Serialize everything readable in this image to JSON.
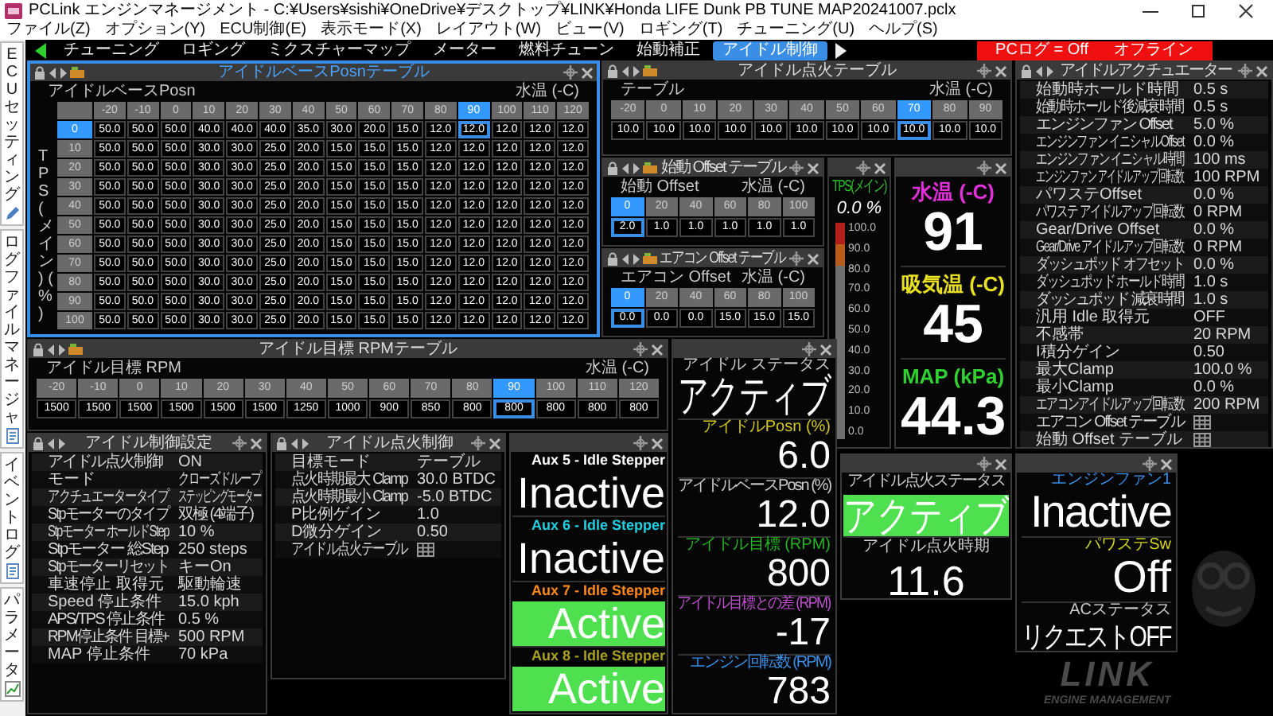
{
  "window": {
    "title": "PCLink エンジンマネージメント - C:¥Users¥sishi¥OneDrive¥デスクトップ¥LINK¥Honda LIFE Dunk PB TUNE MAP20241007.pclx"
  },
  "menu": [
    "ファイル(Z)",
    "オプション(Y)",
    "ECU制御(E)",
    "表示モード(X)",
    "レイアウト(W)",
    "ビュー(V)",
    "ロギング(T)",
    "チューニング(U)",
    "ヘルプ(S)"
  ],
  "side_tabs": [
    {
      "label": "ECUセッティング",
      "kind": "pencil"
    },
    {
      "label": "ログファイルマネージャ",
      "kind": "document"
    },
    {
      "label": "イベントログ",
      "kind": "document"
    },
    {
      "label": "パラメータ",
      "kind": "chart"
    }
  ],
  "tabs": [
    {
      "label": "チューニング",
      "selected": false
    },
    {
      "label": "ロギング",
      "selected": false
    },
    {
      "label": "ミクスチャーマップ",
      "selected": false
    },
    {
      "label": "メーター",
      "selected": false
    },
    {
      "label": "燃料チューン",
      "selected": false
    },
    {
      "label": "始動補正",
      "selected": false
    },
    {
      "label": "アイドル制御",
      "selected": true
    }
  ],
  "status": {
    "pc_log": "PCログ = Off",
    "connection": "オフライン"
  },
  "panels": [
    {
      "kind": "table",
      "title": "アイドルベースPosnテーブル",
      "focused": true,
      "label": "アイドルベースPosn",
      "axis_label": "水温 (-C)",
      "row_axis_label": "TPS (メイン) (%)",
      "columns": [
        {
          "label": "-20",
          "selected": false
        },
        {
          "label": "-10",
          "selected": false
        },
        {
          "label": "0",
          "selected": false
        },
        {
          "label": "10",
          "selected": false
        },
        {
          "label": "20",
          "selected": false
        },
        {
          "label": "30",
          "selected": false
        },
        {
          "label": "40",
          "selected": false
        },
        {
          "label": "50",
          "selected": false
        },
        {
          "label": "60",
          "selected": false
        },
        {
          "label": "70",
          "selected": false
        },
        {
          "label": "80",
          "selected": false
        },
        {
          "label": "90",
          "selected": true
        },
        {
          "label": "100",
          "selected": false
        },
        {
          "label": "110",
          "selected": false
        },
        {
          "label": "120",
          "selected": false
        }
      ],
      "rows": [
        {
          "label": "0",
          "selected": true,
          "cells": [
            "50.0",
            "50.0",
            "50.0",
            "40.0",
            "40.0",
            "40.0",
            "35.0",
            "30.0",
            "20.0",
            "15.0",
            "12.0",
            "12.0",
            "12.0",
            "12.0",
            "12.0"
          ]
        },
        {
          "label": "10",
          "selected": false,
          "cells": [
            "50.0",
            "50.0",
            "50.0",
            "30.0",
            "30.0",
            "25.0",
            "20.0",
            "15.0",
            "15.0",
            "15.0",
            "12.0",
            "12.0",
            "12.0",
            "12.0",
            "12.0"
          ]
        },
        {
          "label": "20",
          "selected": false,
          "cells": [
            "50.0",
            "50.0",
            "50.0",
            "30.0",
            "30.0",
            "25.0",
            "20.0",
            "15.0",
            "15.0",
            "15.0",
            "12.0",
            "12.0",
            "12.0",
            "12.0",
            "12.0"
          ]
        },
        {
          "label": "30",
          "selected": false,
          "cells": [
            "50.0",
            "50.0",
            "50.0",
            "30.0",
            "30.0",
            "25.0",
            "20.0",
            "15.0",
            "15.0",
            "15.0",
            "12.0",
            "12.0",
            "12.0",
            "12.0",
            "12.0"
          ]
        },
        {
          "label": "40",
          "selected": false,
          "cells": [
            "50.0",
            "50.0",
            "50.0",
            "30.0",
            "30.0",
            "25.0",
            "20.0",
            "15.0",
            "15.0",
            "15.0",
            "12.0",
            "12.0",
            "12.0",
            "12.0",
            "12.0"
          ]
        },
        {
          "label": "50",
          "selected": false,
          "cells": [
            "50.0",
            "50.0",
            "50.0",
            "30.0",
            "30.0",
            "25.0",
            "20.0",
            "15.0",
            "15.0",
            "15.0",
            "12.0",
            "12.0",
            "12.0",
            "12.0",
            "12.0"
          ]
        },
        {
          "label": "60",
          "selected": false,
          "cells": [
            "50.0",
            "50.0",
            "50.0",
            "30.0",
            "30.0",
            "25.0",
            "20.0",
            "15.0",
            "15.0",
            "15.0",
            "12.0",
            "12.0",
            "12.0",
            "12.0",
            "12.0"
          ]
        },
        {
          "label": "70",
          "selected": false,
          "cells": [
            "50.0",
            "50.0",
            "50.0",
            "30.0",
            "30.0",
            "25.0",
            "20.0",
            "15.0",
            "15.0",
            "15.0",
            "12.0",
            "12.0",
            "12.0",
            "12.0",
            "12.0"
          ]
        },
        {
          "label": "80",
          "selected": false,
          "cells": [
            "50.0",
            "50.0",
            "50.0",
            "30.0",
            "30.0",
            "25.0",
            "20.0",
            "15.0",
            "15.0",
            "15.0",
            "12.0",
            "12.0",
            "12.0",
            "12.0",
            "12.0"
          ]
        },
        {
          "label": "90",
          "selected": false,
          "cells": [
            "50.0",
            "50.0",
            "50.0",
            "30.0",
            "30.0",
            "25.0",
            "20.0",
            "15.0",
            "15.0",
            "15.0",
            "12.0",
            "12.0",
            "12.0",
            "12.0",
            "12.0"
          ]
        },
        {
          "label": "100",
          "selected": false,
          "cells": [
            "50.0",
            "50.0",
            "50.0",
            "30.0",
            "30.0",
            "25.0",
            "20.0",
            "15.0",
            "15.0",
            "15.0",
            "12.0",
            "12.0",
            "12.0",
            "12.0",
            "12.0"
          ]
        }
      ]
    },
    {
      "kind": "table",
      "title": "アイドル点火テーブル",
      "focused": false,
      "label": "テーブル",
      "axis_label": "水温 (-C)",
      "columns": [
        {
          "label": "-20",
          "selected": false
        },
        {
          "label": "0",
          "selected": false
        },
        {
          "label": "10",
          "selected": false
        },
        {
          "label": "20",
          "selected": false
        },
        {
          "label": "30",
          "selected": false
        },
        {
          "label": "40",
          "selected": false
        },
        {
          "label": "50",
          "selected": false
        },
        {
          "label": "60",
          "selected": false
        },
        {
          "label": "70",
          "selected": true
        },
        {
          "label": "80",
          "selected": false
        },
        {
          "label": "90",
          "selected": false
        }
      ],
      "rows": [
        {
          "cells": [
            "10.0",
            "10.0",
            "10.0",
            "10.0",
            "10.0",
            "10.0",
            "10.0",
            "10.0",
            "10.0",
            "10.0",
            "10.0"
          ]
        }
      ]
    },
    {
      "kind": "settings",
      "title": "アイドルアクチュエーター",
      "focused": false,
      "rows": [
        {
          "kind": "value",
          "label": "始動時ホールド時間",
          "value": "0.5 s"
        },
        {
          "kind": "value",
          "label": "始動時ホールド後減衰時間",
          "value": "0.5 s"
        },
        {
          "kind": "value",
          "label": "エンジンファン Offset",
          "value": "5.0 %"
        },
        {
          "kind": "value",
          "label": "エンジンファン イニシャルOffset",
          "value": "0.0 %"
        },
        {
          "kind": "value",
          "label": "エンジンファン イニシャル時間",
          "value": "100 ms"
        },
        {
          "kind": "value",
          "label": "エンジンファン アイドルアップ回転数",
          "value": "100 RPM"
        },
        {
          "kind": "value",
          "label": "パワステOffset",
          "value": "0.0 %"
        },
        {
          "kind": "value",
          "label": "パワステ アイドルアップ回転数",
          "value": "0 RPM"
        },
        {
          "kind": "value",
          "label": "Gear/Drive Offset",
          "value": "0.0 %"
        },
        {
          "kind": "value",
          "label": "Gear/Drive アイドルアップ回転数",
          "value": "0 RPM"
        },
        {
          "kind": "value",
          "label": "ダッシュポッド オフセット",
          "value": "0.0 %"
        },
        {
          "kind": "value",
          "label": "ダッシュポッド ホールド時間",
          "value": "1.0 s"
        },
        {
          "kind": "value",
          "label": "ダッシュポッド 減衰時間",
          "value": "1.0 s"
        },
        {
          "kind": "value",
          "label": "汎用 Idle 取得元",
          "value": "OFF"
        },
        {
          "kind": "value",
          "label": "不感帯",
          "value": "20 RPM"
        },
        {
          "kind": "value",
          "label": "I積分ゲイン",
          "value": "0.50"
        },
        {
          "kind": "value",
          "label": "最大Clamp",
          "value": "100.0 %"
        },
        {
          "kind": "value",
          "label": "最小Clamp",
          "value": "0.0 %"
        },
        {
          "kind": "value",
          "label": "エアコンアイドルアップ回転数",
          "value": "200 RPM"
        },
        {
          "kind": "table_link",
          "label": "エアコン Offset テーブル"
        },
        {
          "kind": "table_link",
          "label": "始動 Offset テーブル"
        }
      ]
    },
    {
      "kind": "table",
      "title": "始動 Offset テーブル",
      "focused": false,
      "label": "始動 Offset",
      "axis_label": "水温 (-C)",
      "columns": [
        {
          "label": "0",
          "selected": true
        },
        {
          "label": "20",
          "selected": false
        },
        {
          "label": "40",
          "selected": false
        },
        {
          "label": "60",
          "selected": false
        },
        {
          "label": "80",
          "selected": false
        },
        {
          "label": "100",
          "selected": false
        }
      ],
      "rows": [
        {
          "cells": [
            "2.0",
            "1.0",
            "1.0",
            "1.0",
            "1.0",
            "1.0"
          ]
        }
      ]
    },
    {
      "kind": "table",
      "title": "エアコン Offset テーブル",
      "focused": false,
      "label": "エアコン Offset",
      "axis_label": "水温 (-C)",
      "columns": [
        {
          "label": "0",
          "selected": true
        },
        {
          "label": "20",
          "selected": false
        },
        {
          "label": "40",
          "selected": false
        },
        {
          "label": "60",
          "selected": false
        },
        {
          "label": "80",
          "selected": false
        },
        {
          "label": "100",
          "selected": false
        }
      ],
      "rows": [
        {
          "cells": [
            "0.0",
            "0.0",
            "0.0",
            "15.0",
            "15.0",
            "15.0"
          ]
        }
      ]
    },
    {
      "kind": "gauge",
      "focused": false,
      "label": "TPS(メイン)",
      "reading": "0.0 %",
      "level": 0,
      "scale": [
        "100.0",
        "90.0",
        "80.0",
        "70.0",
        "60.0",
        "50.0",
        "40.0",
        "30.0",
        "20.0",
        "10.0",
        "0.0"
      ]
    },
    {
      "kind": "readouts",
      "focused": false,
      "items": [
        {
          "label": "水温 (-C)",
          "color": "#e030d8",
          "value": "91"
        },
        {
          "label": "吸気温 (-C)",
          "color": "#e8e020",
          "value": "45"
        },
        {
          "label": "MAP (kPa)",
          "color": "#30d030",
          "value": "44.3"
        }
      ]
    },
    {
      "kind": "table",
      "title": "アイドル目標 RPMテーブル",
      "focused": false,
      "label": "アイドル目標 RPM",
      "axis_label": "水温 (-C)",
      "columns": [
        {
          "label": "-20",
          "selected": false
        },
        {
          "label": "-10",
          "selected": false
        },
        {
          "label": "0",
          "selected": false
        },
        {
          "label": "10",
          "selected": false
        },
        {
          "label": "20",
          "selected": false
        },
        {
          "label": "30",
          "selected": false
        },
        {
          "label": "40",
          "selected": false
        },
        {
          "label": "50",
          "selected": false
        },
        {
          "label": "60",
          "selected": false
        },
        {
          "label": "70",
          "selected": false
        },
        {
          "label": "80",
          "selected": false
        },
        {
          "label": "90",
          "selected": true
        },
        {
          "label": "100",
          "selected": false
        },
        {
          "label": "110",
          "selected": false
        },
        {
          "label": "120",
          "selected": false
        }
      ],
      "rows": [
        {
          "cells": [
            "1500",
            "1500",
            "1500",
            "1500",
            "1500",
            "1500",
            "1250",
            "1000",
            "900",
            "850",
            "800",
            "800",
            "800",
            "800",
            "800"
          ]
        }
      ]
    },
    {
      "kind": "status",
      "focused": false,
      "items": [
        {
          "label": "アイドル ステータス",
          "color": "#cccccc",
          "value": "アクティブ",
          "highlighted": false
        },
        {
          "label": "アイドルPosn (%)",
          "color": "#d4c81e",
          "value": "6.0",
          "highlighted": false
        },
        {
          "label": "アイドルベースPosn (%)",
          "color": "#cccccc",
          "value": "12.0",
          "highlighted": false
        },
        {
          "label": "アイドル目標 (RPM)",
          "color": "#22b422",
          "value": "800",
          "highlighted": false
        },
        {
          "label": "アイドル目標との差 (RPM)",
          "color": "#c050d0",
          "value": "-17",
          "highlighted": false
        },
        {
          "label": "エンジン回転数 (RPM)",
          "color": "#3a8ee6",
          "value": "783",
          "highlighted": false
        }
      ]
    },
    {
      "kind": "status",
      "focused": false,
      "items": [
        {
          "label": "アイドル点火ステータス",
          "color": "#cccccc",
          "value": "アクティブ",
          "highlighted": true
        },
        {
          "label": "アイドル点火時期",
          "color": "#cccccc",
          "value": "11.6",
          "highlighted": false
        }
      ]
    },
    {
      "kind": "status",
      "focused": false,
      "items": [
        {
          "label": "エンジンファン1",
          "color": "#3a8ee6",
          "value": "Inactive",
          "highlighted": false
        },
        {
          "label": "パワステSw",
          "color": "#d4d41e",
          "value": "Off",
          "highlighted": false
        },
        {
          "label": "ACステータス",
          "color": "#cccccc",
          "value": "リクエストOFF",
          "highlighted": false
        }
      ]
    },
    {
      "kind": "settings",
      "title": "アイドル制御設定",
      "focused": false,
      "rows": [
        {
          "kind": "value",
          "label": "アイドル点火制御",
          "value": "ON"
        },
        {
          "kind": "value",
          "label": "モード",
          "value": "クローズドループ"
        },
        {
          "kind": "value",
          "label": "アクチュエータータイプ",
          "value": "ステッピングモーター"
        },
        {
          "kind": "value",
          "label": "Stpモーターのタイプ",
          "value": "双極 (4端子)"
        },
        {
          "kind": "value",
          "label": "Stpモーター ホールドStep",
          "value": "10 %"
        },
        {
          "kind": "value",
          "label": "Stpモーター 総Step",
          "value": "250 steps"
        },
        {
          "kind": "value",
          "label": "Stpモーターリセット",
          "value": "キーOn"
        },
        {
          "kind": "value",
          "label": "車速停止 取得元",
          "value": "駆動輪速"
        },
        {
          "kind": "value",
          "label": "Speed 停止条件",
          "value": "15.0 kph"
        },
        {
          "kind": "value",
          "label": "APS/TPS 停止条件",
          "value": "0.5 %"
        },
        {
          "kind": "value",
          "label": "RPM停止条件 目標+",
          "value": "500 RPM"
        },
        {
          "kind": "value",
          "label": "MAP 停止条件",
          "value": "70 kPa"
        }
      ]
    },
    {
      "kind": "settings",
      "title": "アイドル点火制御",
      "focused": false,
      "rows": [
        {
          "kind": "value",
          "label": "目標モード",
          "value": "テーブル"
        },
        {
          "kind": "value",
          "label": "点火時期最大 Clamp",
          "value": "30.0 BTDC"
        },
        {
          "kind": "value",
          "label": "点火時期最小 Clamp",
          "value": "-5.0 BTDC"
        },
        {
          "kind": "value",
          "label": "P比例ゲイン",
          "value": "1.0"
        },
        {
          "kind": "value",
          "label": "D微分ゲイン",
          "value": "0.50"
        },
        {
          "kind": "table_link",
          "label": "アイドル点火テーブル"
        }
      ]
    },
    {
      "kind": "status",
      "focused": false,
      "items": [
        {
          "label": "Aux 5 - Idle Stepper",
          "color": "#ffffff",
          "value": "Inactive",
          "highlighted": false
        },
        {
          "label": "Aux 6 - Idle Stepper",
          "color": "#20d0e0",
          "value": "Inactive",
          "highlighted": false
        },
        {
          "label": "Aux 7 - Idle Stepper",
          "color": "#ff8a1a",
          "value": "Active",
          "highlighted": true
        },
        {
          "label": "Aux 8 - Idle Stepper",
          "color": "#a8a020",
          "value": "Active",
          "highlighted": true
        }
      ]
    }
  ],
  "logo": {
    "name": "LINK",
    "tagline": "ENGINE MANAGEMENT"
  }
}
